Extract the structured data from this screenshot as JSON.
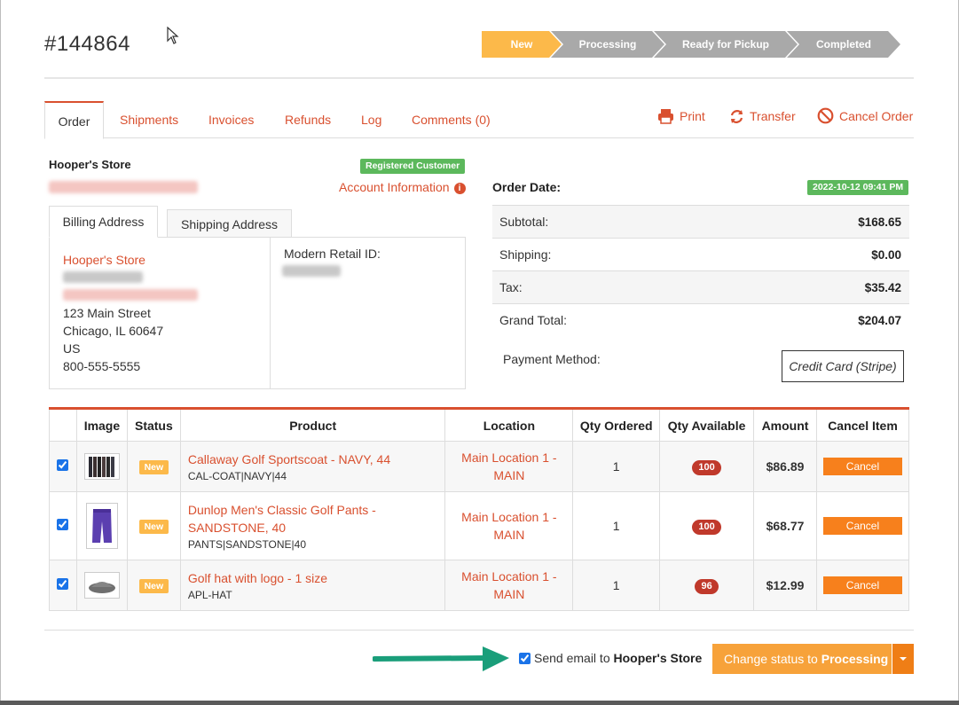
{
  "order": {
    "number": "#144864"
  },
  "status_steps": [
    "New",
    "Processing",
    "Ready for Pickup",
    "Completed"
  ],
  "tabs": [
    "Order",
    "Shipments",
    "Invoices",
    "Refunds",
    "Log",
    "Comments (0)"
  ],
  "actions": {
    "print": "Print",
    "transfer": "Transfer",
    "cancel": "Cancel Order"
  },
  "customer": {
    "store": "Hooper's Store",
    "badge": "Registered Customer",
    "account_info": "Account Information",
    "info_icon": "i"
  },
  "address": {
    "billing_tab": "Billing Address",
    "shipping_tab": "Shipping Address",
    "name": "Hooper's Store",
    "street": "123 Main Street",
    "city": "Chicago, IL 60647",
    "country": "US",
    "phone": "800-555-5555",
    "modern_retail_label": "Modern Retail ID:"
  },
  "totals": {
    "order_date_label": "Order Date:",
    "order_date": "2022-10-12 09:41 PM",
    "rows": [
      {
        "label": "Subtotal:",
        "value": "$168.65"
      },
      {
        "label": "Shipping:",
        "value": "$0.00"
      },
      {
        "label": "Tax:",
        "value": "$35.42"
      },
      {
        "label": "Grand Total:",
        "value": "$204.07"
      }
    ],
    "payment_label": "Payment Method:",
    "payment_value": "Credit Card (Stripe)"
  },
  "items_table": {
    "headers": [
      "",
      "Image",
      "Status",
      "Product",
      "Location",
      "Qty Ordered",
      "Qty Available",
      "Amount",
      "Cancel Item"
    ],
    "rows": [
      {
        "status": "New",
        "name": "Callaway Golf Sportscoat - NAVY, 44",
        "sku": "CAL-COAT|NAVY|44",
        "loc1": "Main Location 1 -",
        "loc2": "MAIN",
        "qty": "1",
        "avail": "100",
        "amount": "$86.89",
        "cancel": "Cancel"
      },
      {
        "status": "New",
        "name1": "Dunlop Men's Classic Golf Pants -",
        "name2": "SANDSTONE, 40",
        "sku": "PANTS|SANDSTONE|40",
        "loc1": "Main Location 1 -",
        "loc2": "MAIN",
        "qty": "1",
        "avail": "100",
        "amount": "$68.77",
        "cancel": "Cancel"
      },
      {
        "status": "New",
        "name": "Golf hat with logo - 1 size",
        "sku": "APL-HAT",
        "loc1": "Main Location 1 -",
        "loc2": "MAIN",
        "qty": "1",
        "avail": "96",
        "amount": "$12.99",
        "cancel": "Cancel"
      }
    ]
  },
  "footer": {
    "send_email_prefix": "Send email to",
    "send_email_name": "Hooper's Store",
    "change_status_prefix": "Change status to",
    "change_status_target": "Processing"
  },
  "colors": {
    "accent": "#d9502f",
    "new": "#fcb94a",
    "step_inactive": "#a9a9a9",
    "success": "#5cb85c",
    "button": "#f7a23a",
    "cancel": "#f7801c",
    "arrow": "#1a9e7a"
  }
}
